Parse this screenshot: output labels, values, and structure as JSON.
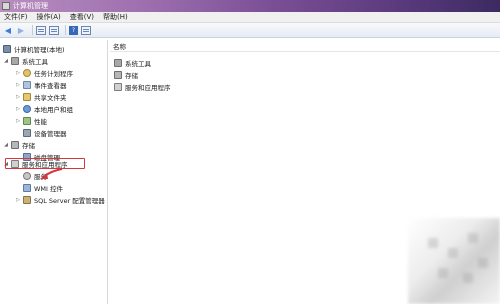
{
  "window": {
    "title": "计算机管理"
  },
  "menu": [
    "文件(F)",
    "操作(A)",
    "查看(V)",
    "帮助(H)"
  ],
  "toolbar": {
    "icons": [
      "back-arrow-icon",
      "forward-arrow-icon",
      "show-tree-icon",
      "export-list-icon",
      "help-icon",
      "properties-icon"
    ]
  },
  "tree": {
    "root": "计算机管理(本地)",
    "system_tools": "系统工具",
    "task_scheduler": "任务计划程序",
    "event_viewer": "事件查看器",
    "shared_folders": "共享文件夹",
    "local_users": "本地用户和组",
    "performance": "性能",
    "device_manager": "设备管理器",
    "storage": "存储",
    "disk_management": "磁盘管理",
    "services_apps": "服务和应用程序",
    "services": "服务",
    "wmi": "WMI 控件",
    "sql": "SQL Server 配置管理器"
  },
  "right": {
    "column_header": "名称",
    "items": [
      "系统工具",
      "存储",
      "服务和应用程序"
    ]
  },
  "annotation": {
    "highlight_color": "#d6373d"
  }
}
